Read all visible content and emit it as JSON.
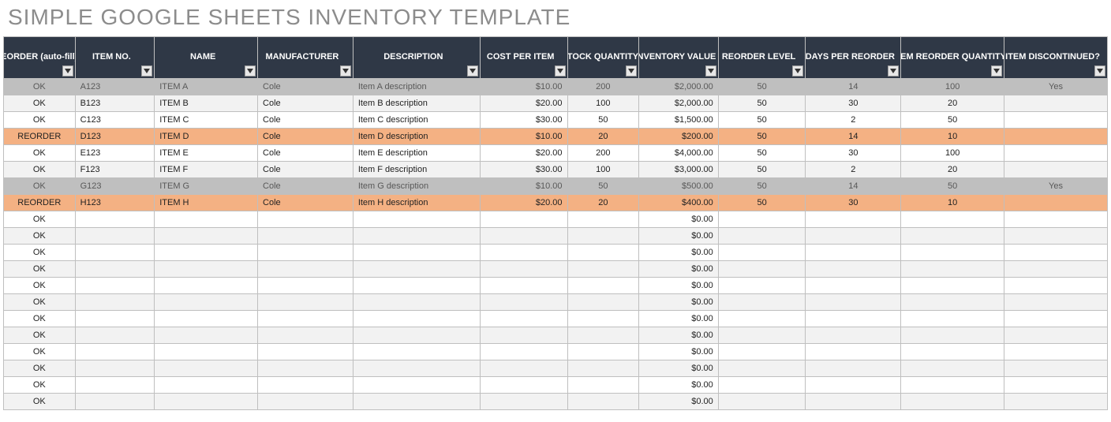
{
  "title": "SIMPLE GOOGLE SHEETS INVENTORY TEMPLATE",
  "headers": [
    "REORDER (auto-fill)",
    "ITEM NO.",
    "NAME",
    "MANUFACTURER",
    "DESCRIPTION",
    "COST PER ITEM",
    "STOCK QUANTITY",
    "INVENTORY VALUE",
    "REORDER LEVEL",
    "DAYS PER REORDER",
    "ITEM REORDER QUANTITY",
    "ITEM DISCONTINUED?"
  ],
  "rows": [
    {
      "state": "disc",
      "reorder": "OK",
      "item_no": "A123",
      "name": "ITEM A",
      "manufacturer": "Cole",
      "description": "Item A description",
      "cost": "$10.00",
      "stock": "200",
      "value": "$2,000.00",
      "reorder_level": "50",
      "days": "14",
      "reorder_qty": "100",
      "discontinued": "Yes"
    },
    {
      "state": "alt",
      "reorder": "OK",
      "item_no": "B123",
      "name": "ITEM B",
      "manufacturer": "Cole",
      "description": "Item B description",
      "cost": "$20.00",
      "stock": "100",
      "value": "$2,000.00",
      "reorder_level": "50",
      "days": "30",
      "reorder_qty": "20",
      "discontinued": ""
    },
    {
      "state": "",
      "reorder": "OK",
      "item_no": "C123",
      "name": "ITEM C",
      "manufacturer": "Cole",
      "description": "Item C description",
      "cost": "$30.00",
      "stock": "50",
      "value": "$1,500.00",
      "reorder_level": "50",
      "days": "2",
      "reorder_qty": "50",
      "discontinued": ""
    },
    {
      "state": "reorder",
      "reorder": "REORDER",
      "item_no": "D123",
      "name": "ITEM D",
      "manufacturer": "Cole",
      "description": "Item D description",
      "cost": "$10.00",
      "stock": "20",
      "value": "$200.00",
      "reorder_level": "50",
      "days": "14",
      "reorder_qty": "10",
      "discontinued": ""
    },
    {
      "state": "",
      "reorder": "OK",
      "item_no": "E123",
      "name": "ITEM E",
      "manufacturer": "Cole",
      "description": "Item E description",
      "cost": "$20.00",
      "stock": "200",
      "value": "$4,000.00",
      "reorder_level": "50",
      "days": "30",
      "reorder_qty": "100",
      "discontinued": ""
    },
    {
      "state": "alt",
      "reorder": "OK",
      "item_no": "F123",
      "name": "ITEM F",
      "manufacturer": "Cole",
      "description": "Item F description",
      "cost": "$30.00",
      "stock": "100",
      "value": "$3,000.00",
      "reorder_level": "50",
      "days": "2",
      "reorder_qty": "20",
      "discontinued": ""
    },
    {
      "state": "disc",
      "reorder": "OK",
      "item_no": "G123",
      "name": "ITEM G",
      "manufacturer": "Cole",
      "description": "Item G description",
      "cost": "$10.00",
      "stock": "50",
      "value": "$500.00",
      "reorder_level": "50",
      "days": "14",
      "reorder_qty": "50",
      "discontinued": "Yes"
    },
    {
      "state": "reorder",
      "reorder": "REORDER",
      "item_no": "H123",
      "name": "ITEM H",
      "manufacturer": "Cole",
      "description": "Item H description",
      "cost": "$20.00",
      "stock": "20",
      "value": "$400.00",
      "reorder_level": "50",
      "days": "30",
      "reorder_qty": "10",
      "discontinued": ""
    },
    {
      "state": "",
      "reorder": "OK",
      "item_no": "",
      "name": "",
      "manufacturer": "",
      "description": "",
      "cost": "",
      "stock": "",
      "value": "$0.00",
      "reorder_level": "",
      "days": "",
      "reorder_qty": "",
      "discontinued": ""
    },
    {
      "state": "alt",
      "reorder": "OK",
      "item_no": "",
      "name": "",
      "manufacturer": "",
      "description": "",
      "cost": "",
      "stock": "",
      "value": "$0.00",
      "reorder_level": "",
      "days": "",
      "reorder_qty": "",
      "discontinued": ""
    },
    {
      "state": "",
      "reorder": "OK",
      "item_no": "",
      "name": "",
      "manufacturer": "",
      "description": "",
      "cost": "",
      "stock": "",
      "value": "$0.00",
      "reorder_level": "",
      "days": "",
      "reorder_qty": "",
      "discontinued": ""
    },
    {
      "state": "alt",
      "reorder": "OK",
      "item_no": "",
      "name": "",
      "manufacturer": "",
      "description": "",
      "cost": "",
      "stock": "",
      "value": "$0.00",
      "reorder_level": "",
      "days": "",
      "reorder_qty": "",
      "discontinued": ""
    },
    {
      "state": "",
      "reorder": "OK",
      "item_no": "",
      "name": "",
      "manufacturer": "",
      "description": "",
      "cost": "",
      "stock": "",
      "value": "$0.00",
      "reorder_level": "",
      "days": "",
      "reorder_qty": "",
      "discontinued": ""
    },
    {
      "state": "alt",
      "reorder": "OK",
      "item_no": "",
      "name": "",
      "manufacturer": "",
      "description": "",
      "cost": "",
      "stock": "",
      "value": "$0.00",
      "reorder_level": "",
      "days": "",
      "reorder_qty": "",
      "discontinued": ""
    },
    {
      "state": "",
      "reorder": "OK",
      "item_no": "",
      "name": "",
      "manufacturer": "",
      "description": "",
      "cost": "",
      "stock": "",
      "value": "$0.00",
      "reorder_level": "",
      "days": "",
      "reorder_qty": "",
      "discontinued": ""
    },
    {
      "state": "alt",
      "reorder": "OK",
      "item_no": "",
      "name": "",
      "manufacturer": "",
      "description": "",
      "cost": "",
      "stock": "",
      "value": "$0.00",
      "reorder_level": "",
      "days": "",
      "reorder_qty": "",
      "discontinued": ""
    },
    {
      "state": "",
      "reorder": "OK",
      "item_no": "",
      "name": "",
      "manufacturer": "",
      "description": "",
      "cost": "",
      "stock": "",
      "value": "$0.00",
      "reorder_level": "",
      "days": "",
      "reorder_qty": "",
      "discontinued": ""
    },
    {
      "state": "alt",
      "reorder": "OK",
      "item_no": "",
      "name": "",
      "manufacturer": "",
      "description": "",
      "cost": "",
      "stock": "",
      "value": "$0.00",
      "reorder_level": "",
      "days": "",
      "reorder_qty": "",
      "discontinued": ""
    },
    {
      "state": "",
      "reorder": "OK",
      "item_no": "",
      "name": "",
      "manufacturer": "",
      "description": "",
      "cost": "",
      "stock": "",
      "value": "$0.00",
      "reorder_level": "",
      "days": "",
      "reorder_qty": "",
      "discontinued": ""
    },
    {
      "state": "alt",
      "reorder": "OK",
      "item_no": "",
      "name": "",
      "manufacturer": "",
      "description": "",
      "cost": "",
      "stock": "",
      "value": "$0.00",
      "reorder_level": "",
      "days": "",
      "reorder_qty": "",
      "discontinued": ""
    }
  ]
}
